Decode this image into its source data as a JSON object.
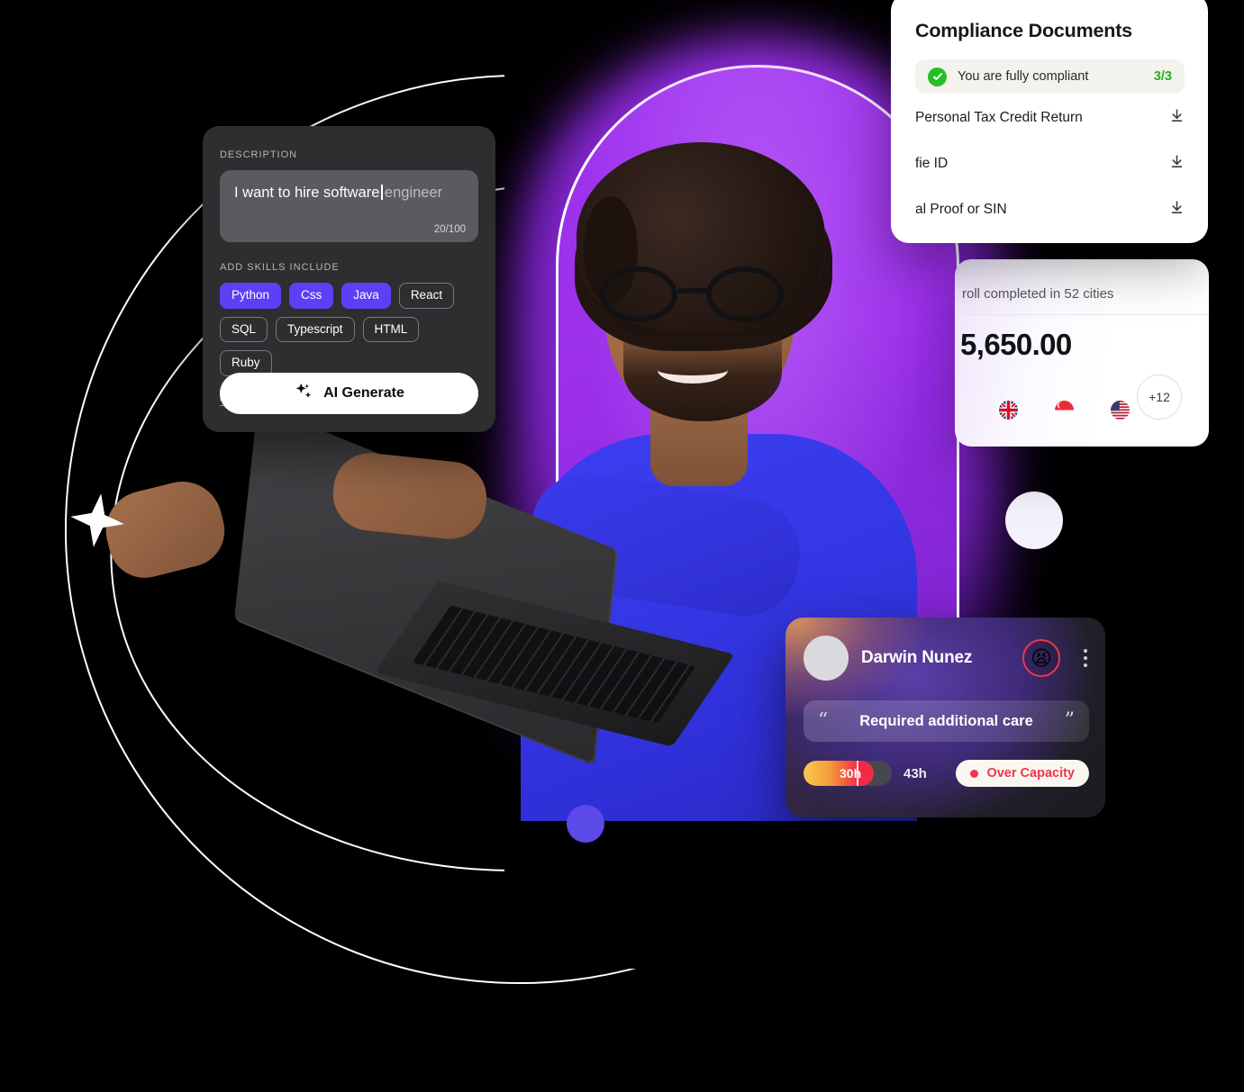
{
  "description_card": {
    "label": "DESCRIPTION",
    "typed_text": "I want to hire software",
    "ghost_text": "engineer",
    "counter": "20/100",
    "skills_label": "ADD SKILLS INCLUDE",
    "skills": [
      {
        "label": "Python",
        "selected": true
      },
      {
        "label": "Css",
        "selected": true
      },
      {
        "label": "Java",
        "selected": true
      },
      {
        "label": "React",
        "selected": false
      },
      {
        "label": "SQL",
        "selected": false
      },
      {
        "label": "Typescript",
        "selected": false
      },
      {
        "label": "HTML",
        "selected": false
      },
      {
        "label": "Ruby",
        "selected": false
      }
    ],
    "add_more": "ADD MORE +",
    "generate_button": "AI Generate",
    "accent_color": "#5D3FF5"
  },
  "compliance_card": {
    "title": "Compliance Documents",
    "status_text": "You are fully compliant",
    "status_count": "3/3",
    "status_color": "#22C024",
    "documents": [
      {
        "name": "Personal Tax Credit Return",
        "action": "download"
      },
      {
        "name": "fie ID",
        "action": "download"
      },
      {
        "name": "al Proof or SIN",
        "action": "download"
      }
    ]
  },
  "payroll_card": {
    "subtitle": "roll completed in 52 cities",
    "amount": "5,650.00",
    "avatars": [
      {
        "flag": "GB"
      },
      {
        "flag": "SG"
      },
      {
        "flag": "US"
      }
    ],
    "overflow_count": "+12"
  },
  "employee_card": {
    "name": "Darwin Nunez",
    "mood_emoji": "😫",
    "mood_ring_color": "#F0344C",
    "quote": "Required additional care",
    "quote_open": "“",
    "quote_close": "”",
    "hours_logged": "30h",
    "hours_total": "43h",
    "capacity_status": "Over Capacity",
    "capacity_percent": 80,
    "status_color": "#F0344C"
  }
}
